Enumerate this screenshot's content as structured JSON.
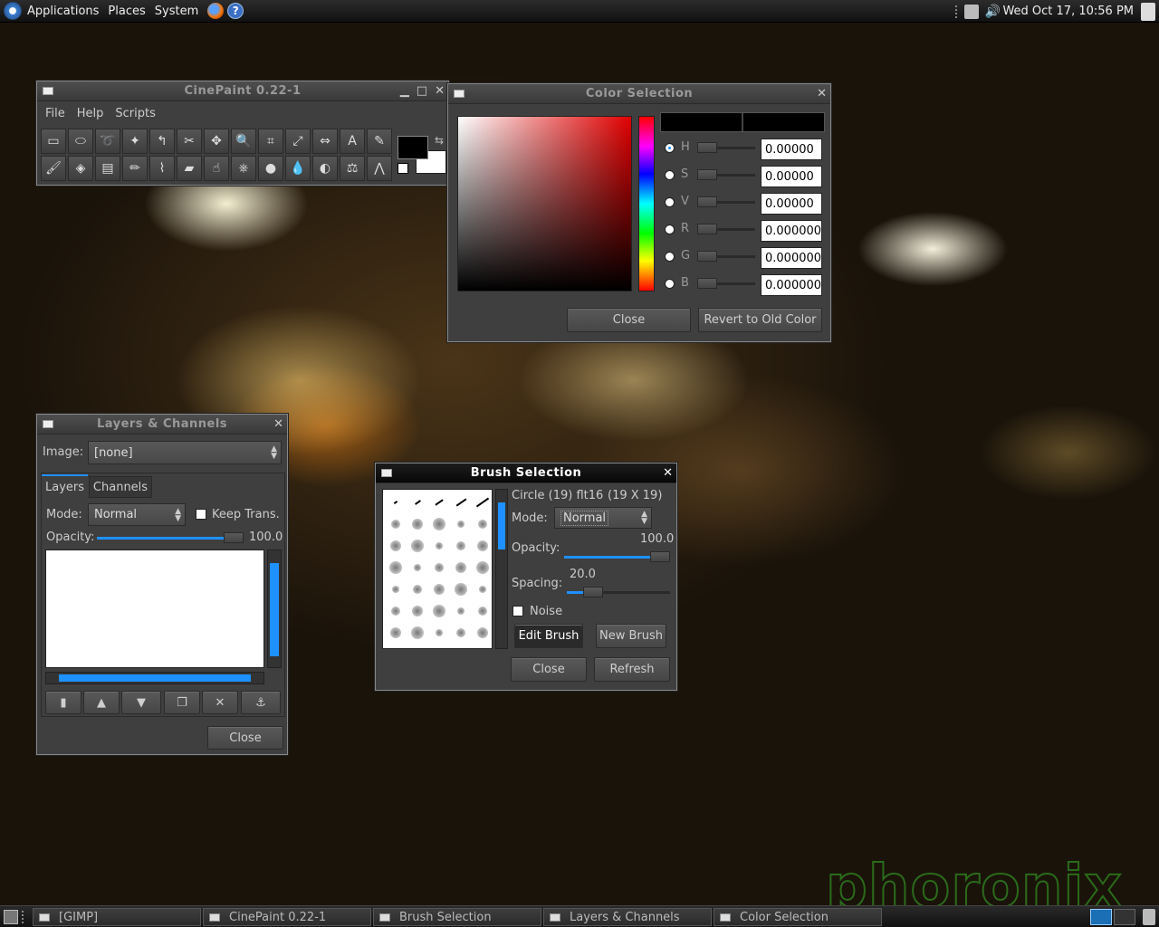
{
  "top_panel": {
    "menus": [
      "Applications",
      "Places",
      "System"
    ],
    "clock": "Wed Oct 17, 10:56 PM"
  },
  "cinepaint": {
    "title": "CinePaint 0.22-1",
    "menu": [
      "File",
      "Help",
      "Scripts"
    ],
    "tools_row1": [
      "rect-select-icon",
      "ellipse-select-icon",
      "lasso-icon",
      "magic-wand-icon",
      "bezier-select-icon",
      "intelligent-scissors-icon",
      "move-icon",
      "zoom-icon",
      "crop-icon",
      "transform-icon",
      "flip-icon",
      "text-icon",
      "color-picker-icon"
    ],
    "tools_row2": [
      "paintbrush-icon",
      "bucket-fill-icon",
      "gradient-icon",
      "pencil-icon",
      "airbrush-icon",
      "eraser-icon",
      "smudge-icon",
      "clone-icon",
      "dodge-burn-icon",
      "blur-icon",
      "convolve-icon",
      "measure-icon",
      "spline-icon"
    ]
  },
  "color_selection": {
    "title": "Color Selection",
    "channels": [
      {
        "label": "H",
        "value": "0.00000"
      },
      {
        "label": "S",
        "value": "0.00000"
      },
      {
        "label": "V",
        "value": "0.00000"
      },
      {
        "label": "R",
        "value": "0.000000"
      },
      {
        "label": "G",
        "value": "0.000000"
      },
      {
        "label": "B",
        "value": "0.000000"
      }
    ],
    "close": "Close",
    "revert": "Revert to Old Color"
  },
  "layers": {
    "title": "Layers & Channels",
    "image_label": "Image:",
    "image_value": "[none]",
    "tabs": [
      "Layers",
      "Channels"
    ],
    "mode_label": "Mode:",
    "mode_value": "Normal",
    "keep_trans": "Keep Trans.",
    "opacity_label": "Opacity:",
    "opacity_value": "100.0",
    "opacity_fraction": 1.0,
    "close": "Close"
  },
  "brush": {
    "title": "Brush Selection",
    "brush_name": "Circle (19) flt16",
    "brush_size": "(19 X 19)",
    "mode_label": "Mode:",
    "mode_value": "Normal",
    "opacity_label": "Opacity:",
    "opacity_value": "100.0",
    "opacity_fraction": 1.0,
    "spacing_label": "Spacing:",
    "spacing_value": "20.0",
    "spacing_fraction": 0.2,
    "noise": "Noise",
    "edit_brush": "Edit Brush",
    "new_brush": "New Brush",
    "close": "Close",
    "refresh": "Refresh"
  },
  "taskbar": {
    "tasks": [
      "[GIMP]",
      "CinePaint 0.22-1",
      "Brush Selection",
      "Layers & Channels",
      "Color Selection"
    ]
  },
  "watermark": "phoronix"
}
